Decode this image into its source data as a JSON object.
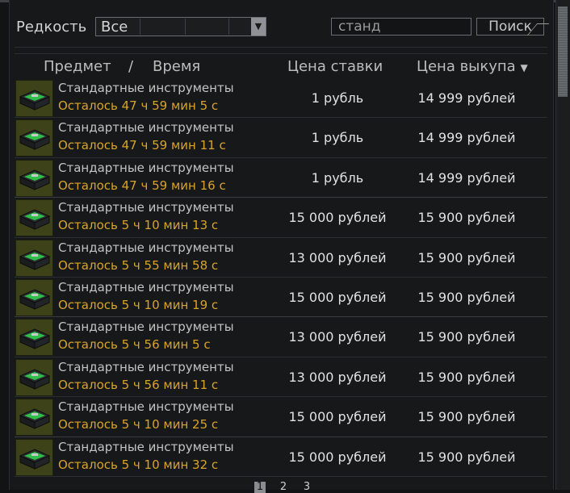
{
  "filter": {
    "rarity_label": "Редкость",
    "rarity_value": "Все",
    "search_value": "станд",
    "search_button": "Поиск"
  },
  "columns": {
    "item": "Предмет",
    "separator": "/",
    "time": "Время",
    "bid": "Цена ставки",
    "buyout": "Цена выкупа",
    "buyout_sort_icon": "sort-desc-icon"
  },
  "rows": [
    {
      "name": "Стандартные инструменты",
      "time": "Осталось 47 ч 59 мин 5 с",
      "bid": "1 рубль",
      "buyout": "14 999 рублей"
    },
    {
      "name": "Стандартные инструменты",
      "time": "Осталось 47 ч 59 мин 11 с",
      "bid": "1 рубль",
      "buyout": "14 999 рублей"
    },
    {
      "name": "Стандартные инструменты",
      "time": "Осталось 47 ч 59 мин 16 с",
      "bid": "1 рубль",
      "buyout": "14 999 рублей"
    },
    {
      "name": "Стандартные инструменты",
      "time": "Осталось 5 ч 10 мин 13 с",
      "bid": "15 000 рублей",
      "buyout": "15 900 рублей"
    },
    {
      "name": "Стандартные инструменты",
      "time": "Осталось 5 ч 55 мин 58 с",
      "bid": "13 000 рублей",
      "buyout": "15 900 рублей"
    },
    {
      "name": "Стандартные инструменты",
      "time": "Осталось 5 ч 10 мин 19 с",
      "bid": "15 000 рублей",
      "buyout": "15 900 рублей"
    },
    {
      "name": "Стандартные инструменты",
      "time": "Осталось 5 ч 56 мин 5 с",
      "bid": "13 000 рублей",
      "buyout": "15 900 рублей"
    },
    {
      "name": "Стандартные инструменты",
      "time": "Осталось 5 ч 56 мин 11 с",
      "bid": "13 000 рублей",
      "buyout": "15 900 рублей"
    },
    {
      "name": "Стандартные инструменты",
      "time": "Осталось 5 ч 10 мин 25 с",
      "bid": "15 000 рублей",
      "buyout": "15 900 рублей"
    },
    {
      "name": "Стандартные инструменты",
      "time": "Осталось 5 ч 10 мин 32 с",
      "bid": "15 000 рублей",
      "buyout": "15 900 рублей"
    }
  ],
  "pagination": {
    "pages": [
      "1",
      "2",
      "3"
    ],
    "current": "1"
  },
  "colors": {
    "time_text": "#d9a428",
    "panel_bg": "#161819"
  }
}
